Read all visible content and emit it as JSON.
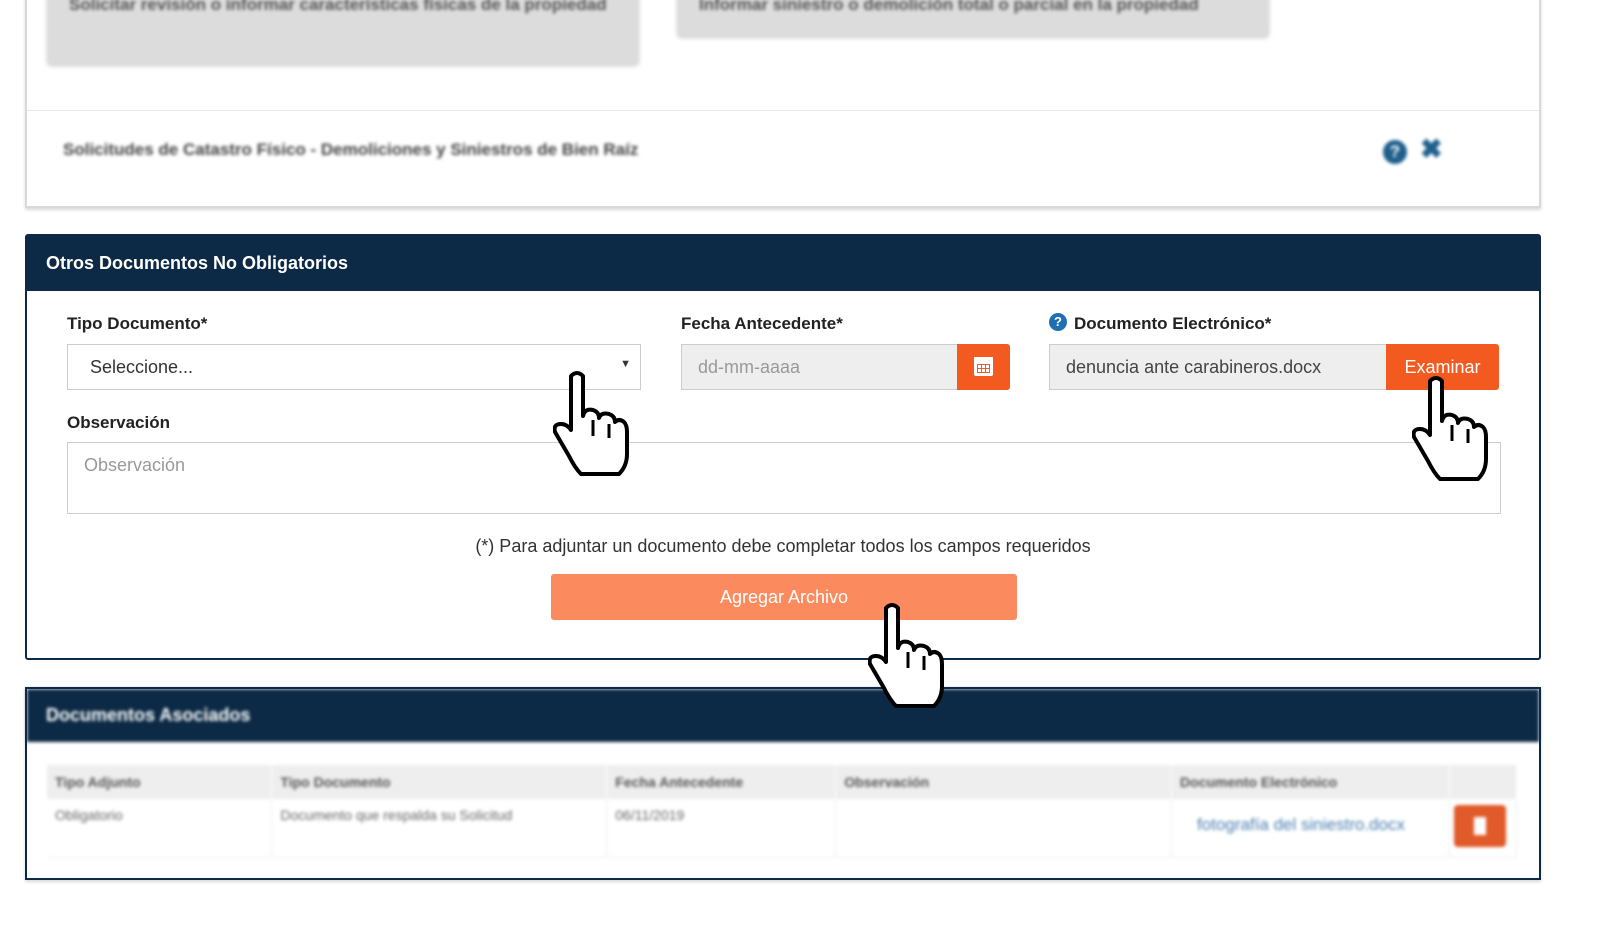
{
  "top_card": {
    "button_a_label": "Solicitar revisión o informar características físicas de la propiedad",
    "button_b_label": "Informar siniestro o demolición total o parcial en la propiedad",
    "row_title": "Solicitudes de Catastro Físico - Demoliciones y Siniestros de Bien Raíz",
    "help_glyph": "?",
    "close_glyph": "✖"
  },
  "form": {
    "title": "Otros Documentos No Obligatorios",
    "tipo_documento_label": "Tipo Documento*",
    "tipo_documento_value": "Seleccione...",
    "caret_glyph": "▼",
    "fecha_label": "Fecha Antecedente*",
    "fecha_placeholder": "dd-mm-aaaa",
    "doc_electronico_label": "Documento Electrónico*",
    "doc_electronico_help_glyph": "?",
    "doc_electronico_value": "denuncia ante carabineros.docx",
    "examinar_label": "Examinar",
    "observacion_label": "Observación",
    "observacion_placeholder": "Observación",
    "required_note": "(*) Para adjuntar un documento debe completar todos los campos requeridos",
    "agregar_label": "Agregar Archivo"
  },
  "docs_table": {
    "title": "Documentos Asociados",
    "columns": [
      "Tipo Adjunto",
      "Tipo Documento",
      "Fecha Antecedente",
      "Observación",
      "Documento Electrónico",
      ""
    ],
    "rows": [
      {
        "tipo_adjunto": "Obligatorio",
        "tipo_documento": "Documento que respalda su Solicitud",
        "fecha": "06/11/2019",
        "observacion": "",
        "documento": "fotografía del siniestro.docx"
      }
    ]
  },
  "colors": {
    "header_navy": "#0c2a46",
    "accent_orange": "#f25a1f",
    "light_orange": "#fb8b5e"
  },
  "icons": [
    "help-icon",
    "close-icon",
    "calendar-icon",
    "dropdown-caret-icon",
    "trash-icon",
    "hand-cursor-icon"
  ]
}
